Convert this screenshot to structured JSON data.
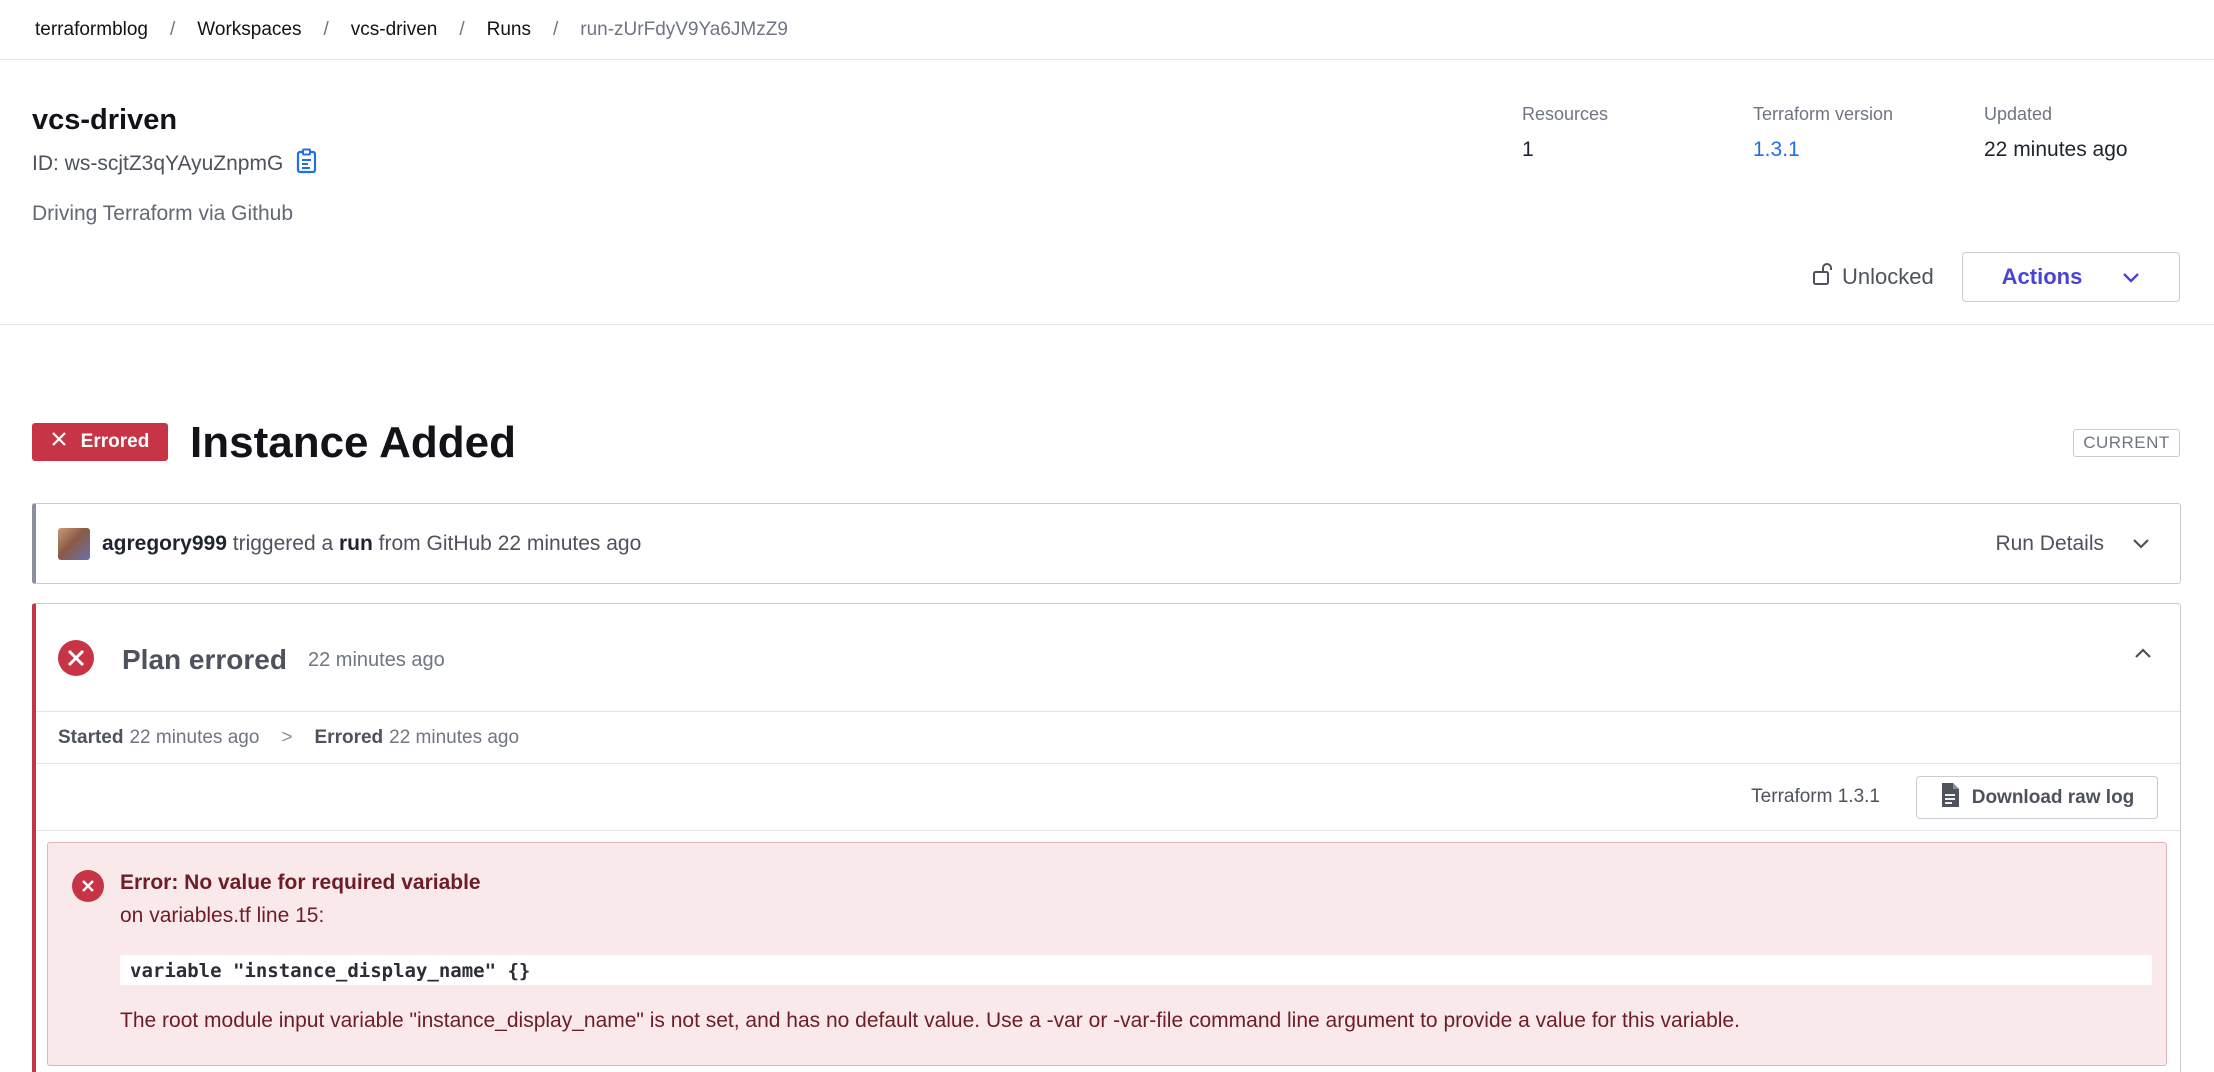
{
  "breadcrumb": {
    "items": [
      "terraformblog",
      "Workspaces",
      "vcs-driven",
      "Runs"
    ],
    "separator": "/",
    "current": "run-zUrFdyV9Ya6JMzZ9"
  },
  "workspace": {
    "name": "vcs-driven",
    "id_text": "ID: ws-scjtZ3qYAyuZnpmG",
    "description": "Driving Terraform via Github",
    "stats": {
      "resources_label": "Resources",
      "resources_value": "1",
      "tf_version_label": "Terraform version",
      "tf_version_value": "1.3.1",
      "updated_label": "Updated",
      "updated_value": "22 minutes ago"
    },
    "lock_status": "Unlocked",
    "actions_label": "Actions"
  },
  "run": {
    "status_badge": "Errored",
    "title": "Instance Added",
    "current_badge": "CURRENT",
    "trigger": {
      "user": "agregory999",
      "text1": "triggered a",
      "run_word": "run",
      "text2": "from GitHub 22 minutes ago",
      "details_label": "Run Details"
    }
  },
  "plan": {
    "title": "Plan errored",
    "time": "22 minutes ago",
    "started_label": "Started",
    "started_time": "22 minutes ago",
    "arrow": ">",
    "errored_label": "Errored",
    "errored_time": "22 minutes ago",
    "terraform_version": "Terraform 1.3.1",
    "download_label": "Download raw log",
    "error": {
      "title": "Error: No value for required variable",
      "location": "on variables.tf line 15:",
      "code": "variable \"instance_display_name\" {}",
      "description": "The root module input variable \"instance_display_name\" is not set, and has no default value. Use a -var or -var-file command line argument to provide a value for this variable."
    }
  },
  "colors": {
    "error_red": "#c73445",
    "link_blue": "#1f6feb",
    "actions_purple": "#4a44d4",
    "error_bg": "#f9e9ea"
  }
}
